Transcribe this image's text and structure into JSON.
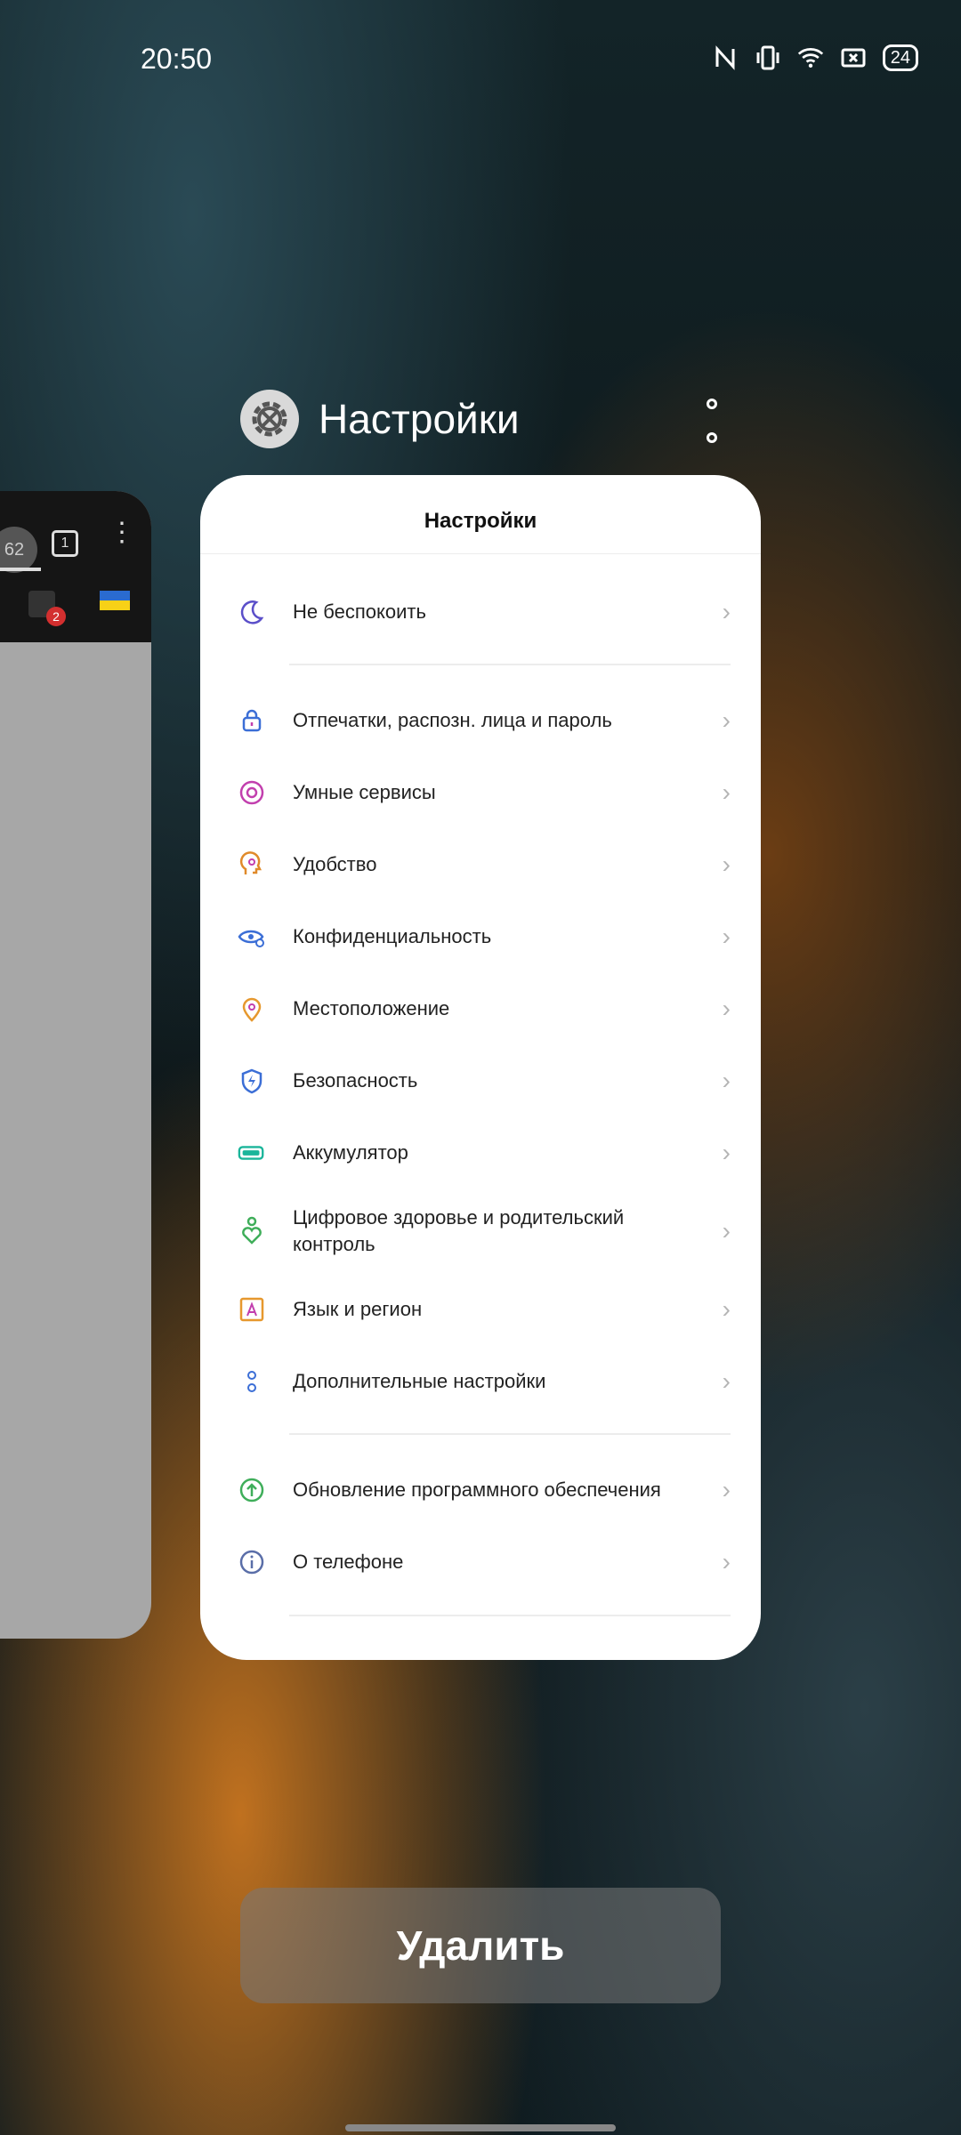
{
  "status_bar": {
    "time": "20:50",
    "battery": "24",
    "icons": [
      "nfc-icon",
      "vibrate-icon",
      "wifi-icon",
      "screenshot-icon",
      "battery-icon"
    ]
  },
  "left_card": {
    "tab_count": "1",
    "url_hint": "62",
    "notification_badge": "2"
  },
  "app_header": {
    "title": "Настройки",
    "icon": "gear-icon"
  },
  "settings_card": {
    "title": "Настройки",
    "items": [
      {
        "label": "Не беспокоить",
        "icon": "moon-icon",
        "color": "#5b4fc9"
      },
      {
        "label": "Отпечатки, распозн. лица и пароль",
        "icon": "lock-icon",
        "color": "#3b6ed6"
      },
      {
        "label": "Умные сервисы",
        "icon": "smart-services-icon",
        "color": "#c23fae"
      },
      {
        "label": "Удобство",
        "icon": "convenience-icon",
        "color": "#e08a2a"
      },
      {
        "label": "Конфиденциальность",
        "icon": "privacy-eye-icon",
        "color": "#3b6ed6"
      },
      {
        "label": "Местоположение",
        "icon": "location-pin-icon",
        "color": "#e6982e"
      },
      {
        "label": "Безопасность",
        "icon": "shield-bolt-icon",
        "color": "#3b6ed6"
      },
      {
        "label": "Аккумулятор",
        "icon": "battery-icon",
        "color": "#1ab59a"
      },
      {
        "label": "Цифровое здоровье и родительский контроль",
        "icon": "digital-wellbeing-icon",
        "color": "#3fae5a"
      },
      {
        "label": "Язык и регион",
        "icon": "language-icon",
        "color": "#e6982e"
      },
      {
        "label": "Дополнительные настройки",
        "icon": "more-settings-icon",
        "color": "#3b6ed6"
      },
      {
        "label": "Обновление программного обеспечения",
        "icon": "update-arrow-icon",
        "color": "#3fae5a"
      },
      {
        "label": "О телефоне",
        "icon": "info-icon",
        "color": "#5a6ea8"
      }
    ]
  },
  "delete_button": {
    "label": "Удалить"
  }
}
